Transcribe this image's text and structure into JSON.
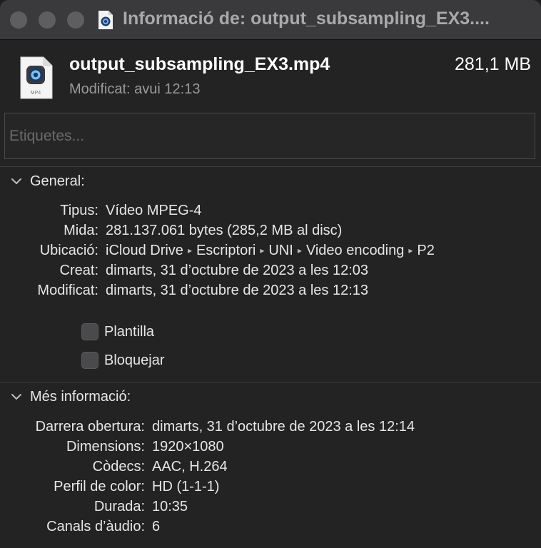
{
  "window": {
    "title": "Informació de: output_subsampling_EX3...."
  },
  "header": {
    "file_name": "output_subsampling_EX3.mp4",
    "file_size": "281,1 MB",
    "modified": "Modificat: avui 12:13",
    "file_icon_label": "MP4"
  },
  "tags": {
    "placeholder": "Etiquetes..."
  },
  "general": {
    "title": "General:",
    "rows": [
      {
        "label": "Tipus:",
        "value": "Vídeo MPEG-4"
      },
      {
        "label": "Mida:",
        "value": "281.137.061 bytes (285,2 MB al disc)"
      },
      {
        "label": "Ubicació:",
        "path": [
          "iCloud Drive",
          "Escriptori",
          "UNI",
          "Video encoding",
          "P2"
        ]
      },
      {
        "label": "Creat:",
        "value": "dimarts, 31 d’octubre de 2023 a les 12:03"
      },
      {
        "label": "Modificat:",
        "value": "dimarts, 31 d’octubre de 2023 a les 12:13"
      }
    ],
    "path_separator": "▸",
    "checkboxes": [
      {
        "label": "Plantilla",
        "checked": false
      },
      {
        "label": "Bloquejar",
        "checked": false
      }
    ]
  },
  "more_info": {
    "title": "Més informació:",
    "rows": [
      {
        "label": "Darrera obertura:",
        "value": "dimarts, 31 d’octubre de 2023 a les 12:14"
      },
      {
        "label": "Dimensions:",
        "value": "1920×1080"
      },
      {
        "label": "Còdecs:",
        "value": "AAC, H.264"
      },
      {
        "label": "Perfil de color:",
        "value": "HD (1-1-1)"
      },
      {
        "label": "Durada:",
        "value": "10:35"
      },
      {
        "label": "Canals d’àudio:",
        "value": "6"
      }
    ]
  },
  "icons": {
    "traffic_lights": [
      "close-button",
      "minimize-button",
      "zoom-button"
    ],
    "file_icon": "quicktime-movie-icon",
    "disclosure": "chevron-down-icon"
  },
  "colors": {
    "background": "#232323",
    "titlebar": "#3a3a3c",
    "text": "#e6e6e6",
    "secondary_text": "#9a9a9c",
    "traffic_light_inactive": "#5e5e60"
  }
}
